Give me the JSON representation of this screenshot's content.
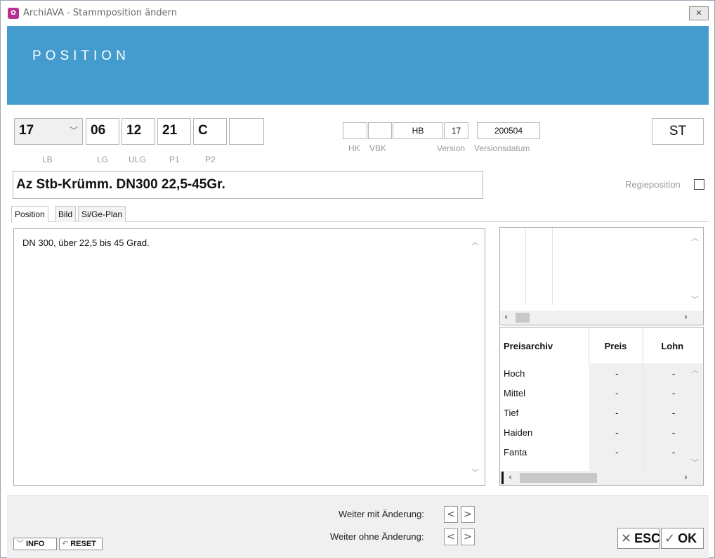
{
  "window": {
    "title": "ArchiAVA - Stammposition ändern",
    "close_glyph": "✕",
    "app_icon": "archiava-icon"
  },
  "banner": {
    "title": "POSITION"
  },
  "position_fields": {
    "lb": {
      "value": "17",
      "label": "LB"
    },
    "lg": {
      "value": "06",
      "label": "LG"
    },
    "ulg": {
      "value": "12",
      "label": "ULG"
    },
    "p1": {
      "value": "21",
      "label": "P1"
    },
    "p2": {
      "value": "C",
      "label": "P2"
    },
    "extra": {
      "value": ""
    }
  },
  "meta_fields": {
    "hk": {
      "value": "",
      "label": "HK"
    },
    "vbk": {
      "value": "",
      "label": "VBK"
    },
    "hb": {
      "value": "HB"
    },
    "version": {
      "value": "17",
      "label": "Version"
    },
    "versionsdatum": {
      "value": "200504",
      "label": "Versionsdatum"
    },
    "unit": {
      "value": "ST"
    }
  },
  "short_text": "Az Stb-Krümm. DN300 22,5-45Gr.",
  "regie": {
    "label": "Regieposition",
    "checked": false
  },
  "tabs": [
    {
      "label": "Position",
      "active": true
    },
    {
      "label": "Bild",
      "active": false
    },
    {
      "label": "Si/Ge-Plan",
      "active": false
    }
  ],
  "long_text": "DN 300, über 22,5 bis 45 Grad.",
  "price_archive": {
    "headers": [
      "Preisarchiv",
      "Preis",
      "Lohn"
    ],
    "rows": [
      {
        "name": "Hoch",
        "preis": "-",
        "lohn": "-"
      },
      {
        "name": "Mittel",
        "preis": "-",
        "lohn": "-"
      },
      {
        "name": "Tief",
        "preis": "-",
        "lohn": "-"
      },
      {
        "name": "Haiden",
        "preis": "-",
        "lohn": "-"
      },
      {
        "name": "Fanta",
        "preis": "-",
        "lohn": "-"
      }
    ]
  },
  "footer": {
    "weiter_mit": "Weiter mit Änderung:",
    "weiter_ohne": "Weiter ohne Änderung:",
    "prev_glyph": "<",
    "next_glyph": ">",
    "info_label": "INFO",
    "reset_label": "RESET",
    "esc_label": "ESC",
    "ok_label": "OK"
  },
  "colors": {
    "banner": "#439ccd",
    "app_icon": "#b7308f",
    "footer_bg": "#f0f0f0"
  }
}
